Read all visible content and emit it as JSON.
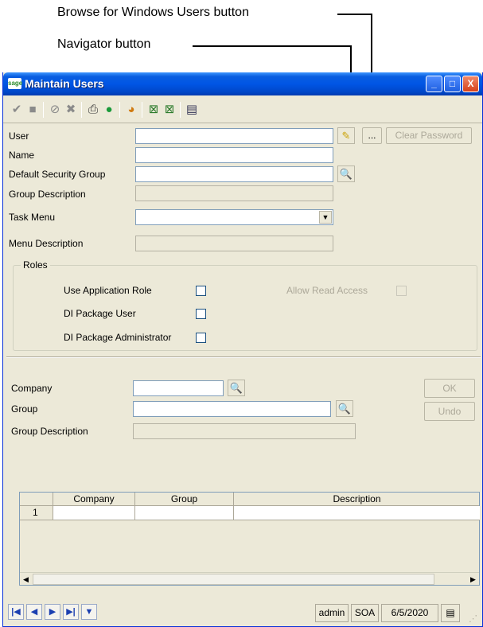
{
  "callouts": {
    "browse_windows_users": "Browse for Windows Users button",
    "navigator": "Navigator button"
  },
  "window": {
    "app_logo": "sage",
    "title": "Maintain Users",
    "controls": {
      "minimize": "_",
      "maximize": "□",
      "close": "X"
    }
  },
  "toolbar": {
    "icons": [
      "check-icon",
      "save-icon",
      "cancel-icon",
      "delete-icon",
      "print-icon",
      "help-icon",
      "chart-icon",
      "export-icon",
      "import-icon",
      "settings-icon"
    ]
  },
  "form": {
    "user_label": "User",
    "user_value": "",
    "name_label": "Name",
    "name_value": "",
    "default_security_group_label": "Default Security Group",
    "default_security_group_value": "",
    "group_description_label": "Group Description",
    "group_description_value": "",
    "task_menu_label": "Task Menu",
    "task_menu_value": "",
    "menu_description_label": "Menu Description",
    "menu_description_value": "",
    "navigator_button_label": "...",
    "clear_password_label": "Clear Password"
  },
  "roles": {
    "title": "Roles",
    "use_application_role": "Use Application Role",
    "allow_read_access": "Allow Read Access",
    "di_package_user": "DI Package User",
    "di_package_administrator": "DI Package Administrator"
  },
  "company_section": {
    "company_label": "Company",
    "company_value": "",
    "group_label": "Group",
    "group_value": "",
    "group_description_label": "Group Description",
    "group_description_value": "",
    "ok_label": "OK",
    "undo_label": "Undo"
  },
  "grid": {
    "columns": [
      "Company",
      "Group",
      "Description"
    ],
    "rows": [
      {
        "row_num": "1",
        "company": "",
        "group": "",
        "description": ""
      }
    ]
  },
  "status": {
    "user": "admin",
    "company": "SOA",
    "date": "6/5/2020"
  }
}
